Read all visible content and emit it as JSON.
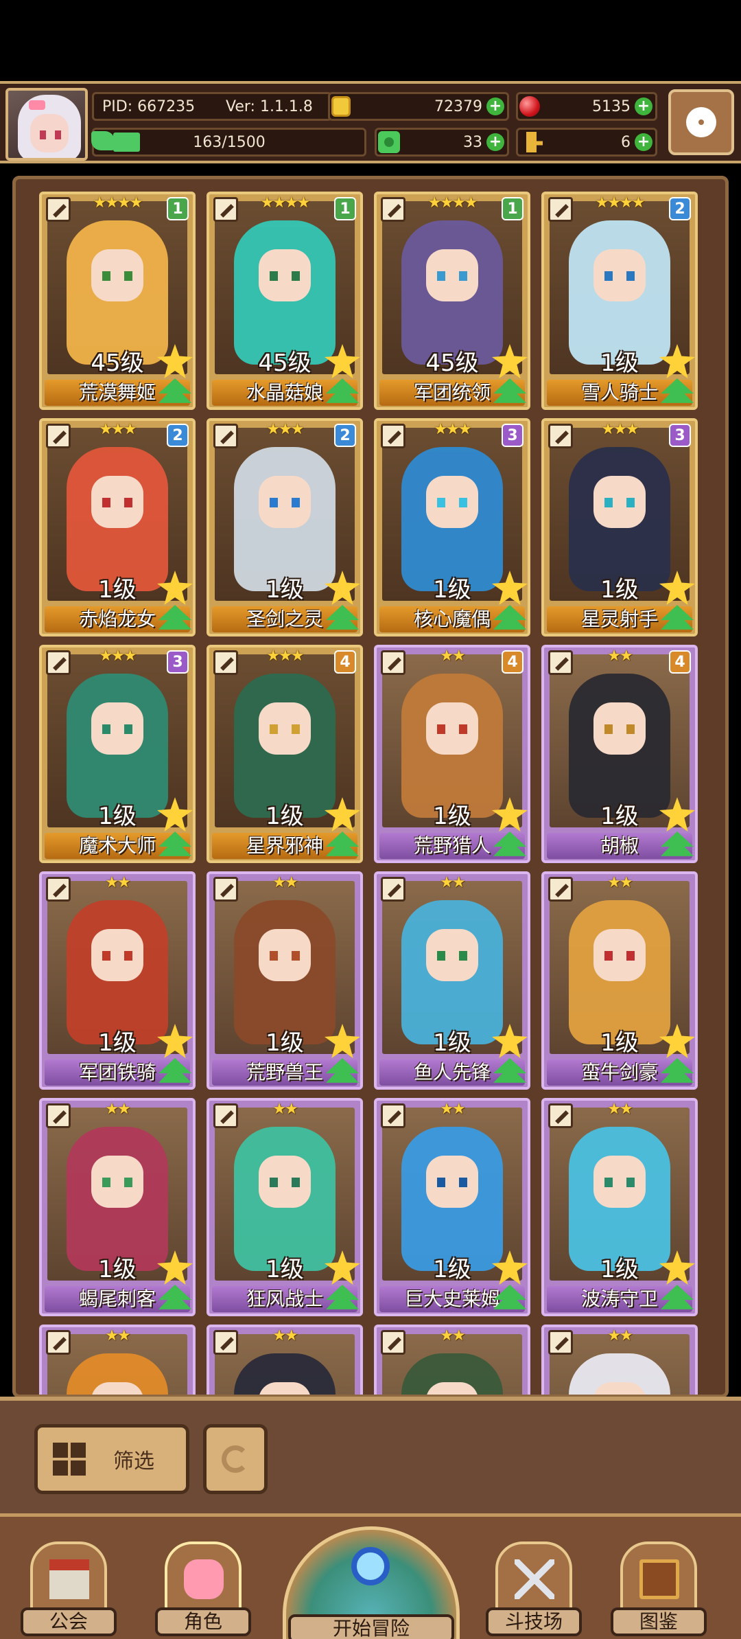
{
  "header": {
    "pid": "PID: 667235",
    "version": "Ver: 1.1.1.8",
    "coins": "72379",
    "gems": "5135",
    "stamina": "163/1500",
    "stamina_fraction": 0.1087,
    "clover": "33",
    "keys": "6"
  },
  "heroes": [
    {
      "name": "荒漠舞姬",
      "level": "45级",
      "stars": "★★★★",
      "badge": "1",
      "tier": "gold",
      "color": "#f0b24a",
      "eye": "#3a8c3a"
    },
    {
      "name": "水晶菇娘",
      "level": "45级",
      "stars": "★★★★",
      "badge": "1",
      "tier": "gold",
      "color": "#35c6b4",
      "eye": "#2a7a4a"
    },
    {
      "name": "军团统领",
      "level": "45级",
      "stars": "★★★★",
      "badge": "1",
      "tier": "gold",
      "color": "#6a5a9a",
      "eye": "#3a9ad0"
    },
    {
      "name": "雪人骑士",
      "level": "1级",
      "stars": "★★★★",
      "badge": "2",
      "tier": "gold",
      "color": "#bfe3f2",
      "eye": "#2a78c0"
    },
    {
      "name": "赤焰龙女",
      "level": "1级",
      "stars": "★★★",
      "badge": "2",
      "tier": "gold",
      "color": "#e0563a",
      "eye": "#c03030"
    },
    {
      "name": "圣剑之灵",
      "level": "1级",
      "stars": "★★★",
      "badge": "2",
      "tier": "gold",
      "color": "#cfd8e0",
      "eye": "#2a7ad0"
    },
    {
      "name": "核心魔偶",
      "level": "1级",
      "stars": "★★★",
      "badge": "3",
      "tier": "gold",
      "color": "#2f8ad0",
      "eye": "#3ac0e0"
    },
    {
      "name": "星灵射手",
      "level": "1级",
      "stars": "★★★",
      "badge": "3",
      "tier": "gold",
      "color": "#2a2f4a",
      "eye": "#2ab0c0"
    },
    {
      "name": "魔术大师",
      "level": "1级",
      "stars": "★★★",
      "badge": "3",
      "tier": "gold",
      "color": "#2f8a72",
      "eye": "#2a8a6a"
    },
    {
      "name": "星界邪神",
      "level": "1级",
      "stars": "★★★",
      "badge": "4",
      "tier": "gold",
      "color": "#2d6a4f",
      "eye": "#d0a030"
    },
    {
      "name": "荒野猎人",
      "level": "1级",
      "stars": "★★",
      "badge": "4",
      "tier": "purple",
      "color": "#c07a3a",
      "eye": "#c03a2a"
    },
    {
      "name": "胡椒",
      "level": "1级",
      "stars": "★★",
      "badge": "4",
      "tier": "purple",
      "color": "#2a2a30",
      "eye": "#c08a2a"
    },
    {
      "name": "军团铁骑",
      "level": "1级",
      "stars": "★★",
      "badge": "",
      "tier": "purple",
      "color": "#c0402a",
      "eye": "#c03a2a"
    },
    {
      "name": "荒野兽王",
      "level": "1级",
      "stars": "★★",
      "badge": "",
      "tier": "purple",
      "color": "#8a4a2a",
      "eye": "#b0502a"
    },
    {
      "name": "鱼人先锋",
      "level": "1级",
      "stars": "★★",
      "badge": "",
      "tier": "purple",
      "color": "#4ab0d8",
      "eye": "#2a8a4a"
    },
    {
      "name": "蛮牛剑豪",
      "level": "1级",
      "stars": "★★",
      "badge": "",
      "tier": "purple",
      "color": "#e0a040",
      "eye": "#c03030"
    },
    {
      "name": "蝎尾刺客",
      "level": "1级",
      "stars": "★★",
      "badge": "",
      "tier": "purple",
      "color": "#b03a5a",
      "eye": "#3a9a5a"
    },
    {
      "name": "狂风战士",
      "level": "1级",
      "stars": "★★",
      "badge": "",
      "tier": "purple",
      "color": "#3fc0a0",
      "eye": "#2a7a5a"
    },
    {
      "name": "巨大史莱姆",
      "level": "1级",
      "stars": "★★",
      "badge": "",
      "tier": "purple",
      "color": "#3a9ae0",
      "eye": "#1a5aa0"
    },
    {
      "name": "波涛守卫",
      "level": "1级",
      "stars": "★★",
      "badge": "",
      "tier": "purple",
      "color": "#4ac0e0",
      "eye": "#2a8a6a"
    },
    {
      "name": "",
      "level": "",
      "stars": "★★",
      "badge": "",
      "tier": "purple",
      "color": "#e08a2a",
      "eye": "#c03030"
    },
    {
      "name": "",
      "level": "",
      "stars": "★★",
      "badge": "",
      "tier": "purple",
      "color": "#2a2a3a",
      "eye": "#c03030"
    },
    {
      "name": "",
      "level": "",
      "stars": "★★",
      "badge": "",
      "tier": "purple",
      "color": "#3a5a3a",
      "eye": "#c03030"
    },
    {
      "name": "",
      "level": "",
      "stars": "★★",
      "badge": "",
      "tier": "purple",
      "color": "#e8e8f0",
      "eye": "#c03030"
    }
  ],
  "filter": {
    "label": "筛选"
  },
  "nav": {
    "guild": "公会",
    "character": "角色",
    "adventure": "开始冒险",
    "arena": "斗技场",
    "codex": "图鉴"
  },
  "colors": {
    "badge_green": "#4aa64a",
    "badge_blue": "#3a8ad8",
    "badge_purple": "#9a5ac8",
    "badge_orange": "#d88a2a"
  }
}
